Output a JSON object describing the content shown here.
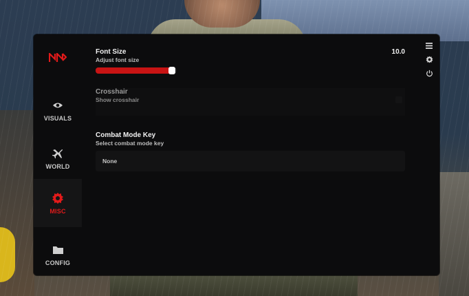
{
  "sidebar": {
    "items": [
      {
        "label": "VISUALS",
        "icon": "eye-icon"
      },
      {
        "label": "WORLD",
        "icon": "plane-icon"
      },
      {
        "label": "MISC",
        "icon": "gear-cog-icon",
        "active": true
      },
      {
        "label": "CONFIG",
        "icon": "folder-icon"
      }
    ]
  },
  "settings": {
    "font_size": {
      "title": "Font Size",
      "description": "Adjust font size",
      "value": "10.0",
      "fill_fraction": 0.97
    },
    "crosshair": {
      "title": "Crosshair",
      "description": "Show crosshair",
      "enabled": false
    },
    "combat_mode_key": {
      "title": "Combat Mode Key",
      "description": "Select combat mode key",
      "selected": "None"
    }
  },
  "rightbar": {
    "icons": [
      "menu-icon",
      "settings-icon",
      "power-icon"
    ]
  },
  "colors": {
    "accent": "#e21a1a",
    "panel": "#0c0c0d",
    "slider_fill": "#c81414"
  }
}
